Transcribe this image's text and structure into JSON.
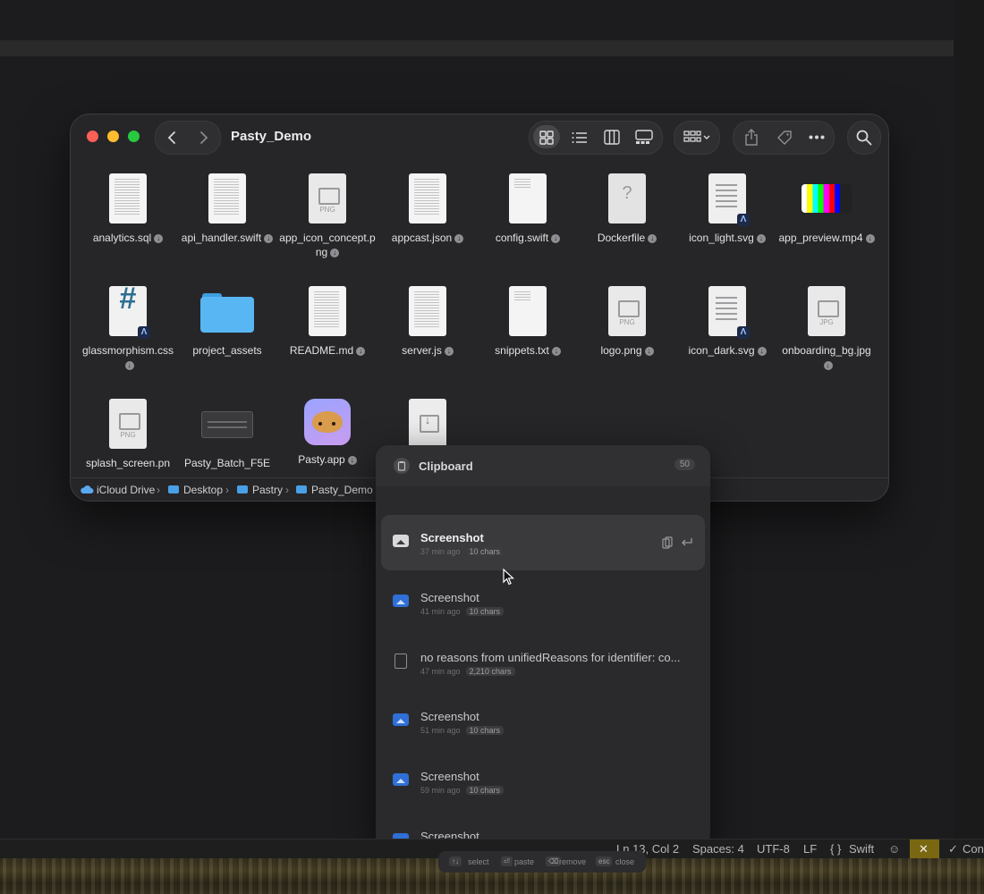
{
  "finder": {
    "title": "Pasty_Demo",
    "files": [
      {
        "name": "analytics.sql",
        "kind": "doc-lines",
        "download": true
      },
      {
        "name": "api_handler.swift",
        "kind": "doc-lines",
        "download": true
      },
      {
        "name": "app_icon_concept.png",
        "kind": "image",
        "ext": "PNG",
        "download": true
      },
      {
        "name": "appcast.json",
        "kind": "doc-lines",
        "download": true
      },
      {
        "name": "config.swift",
        "kind": "doc-blank",
        "download": true
      },
      {
        "name": "Dockerfile",
        "kind": "unknown",
        "download": true
      },
      {
        "name": "icon_light.svg",
        "kind": "vector",
        "download": true
      },
      {
        "name": "app_preview.mp4",
        "kind": "video",
        "download": true
      },
      {
        "name": "glassmorphism.css",
        "kind": "css",
        "download": true
      },
      {
        "name": "project_assets",
        "kind": "folder",
        "download": false
      },
      {
        "name": "README.md",
        "kind": "doc-lines",
        "download": true
      },
      {
        "name": "server.js",
        "kind": "doc-lines",
        "download": true
      },
      {
        "name": "snippets.txt",
        "kind": "doc-blank",
        "download": true
      },
      {
        "name": "logo.png",
        "kind": "image",
        "ext": "PNG",
        "download": true
      },
      {
        "name": "icon_dark.svg",
        "kind": "vector",
        "download": true
      },
      {
        "name": "onboarding_bg.jpg",
        "kind": "image",
        "ext": "JPG",
        "download": true
      },
      {
        "name": "splash_screen.pn",
        "kind": "image",
        "ext": "PNG",
        "download": false
      },
      {
        "name": "Pasty_Batch_F5E",
        "kind": "screenshot",
        "download": false
      },
      {
        "name": "Pasty.app",
        "kind": "app",
        "download": true
      },
      {
        "name": "",
        "kind": "installer",
        "download": false
      }
    ],
    "path": [
      "iCloud Drive",
      "Desktop",
      "Pastry",
      "Pasty_Demo"
    ],
    "path_sep": "›",
    "download_glyph": "↓"
  },
  "clipboard": {
    "title": "Clipboard",
    "count": "50",
    "items": [
      {
        "name": "Screenshot",
        "time": "37 min ago",
        "size": "10 chars",
        "type": "image",
        "selected": true
      },
      {
        "name": "Screenshot",
        "time": "41 min ago",
        "size": "10 chars",
        "type": "image",
        "selected": false
      },
      {
        "name": "no reasons from unifiedReasons for identifier: co...",
        "time": "47 min ago",
        "size": "2,210 chars",
        "type": "text",
        "selected": false
      },
      {
        "name": "Screenshot",
        "time": "51 min ago",
        "size": "10 chars",
        "type": "image",
        "selected": false
      },
      {
        "name": "Screenshot",
        "time": "59 min ago",
        "size": "10 chars",
        "type": "image",
        "selected": false
      },
      {
        "name": "Screenshot",
        "time": "",
        "size": "",
        "type": "image",
        "selected": false
      }
    ],
    "hints": [
      {
        "key": "↑↓",
        "label": "select"
      },
      {
        "key": "⏎",
        "label": "paste"
      },
      {
        "key": "⌫",
        "label": "remove"
      },
      {
        "key": "esc",
        "label": "close"
      }
    ]
  },
  "status_bar": {
    "position": "Ln 13, Col 2",
    "spaces": "Spaces: 4",
    "encoding": "UTF-8",
    "eol": "LF",
    "language_glyph": "{ }",
    "language": "Swift",
    "copilot_glyph": "☺",
    "warn_glyph": "✕",
    "check_glyph": "✓",
    "truncated": "Con"
  },
  "icons": {
    "back": "chevron-left-icon",
    "forward": "chevron-right-icon",
    "search": "magnifier-icon"
  }
}
